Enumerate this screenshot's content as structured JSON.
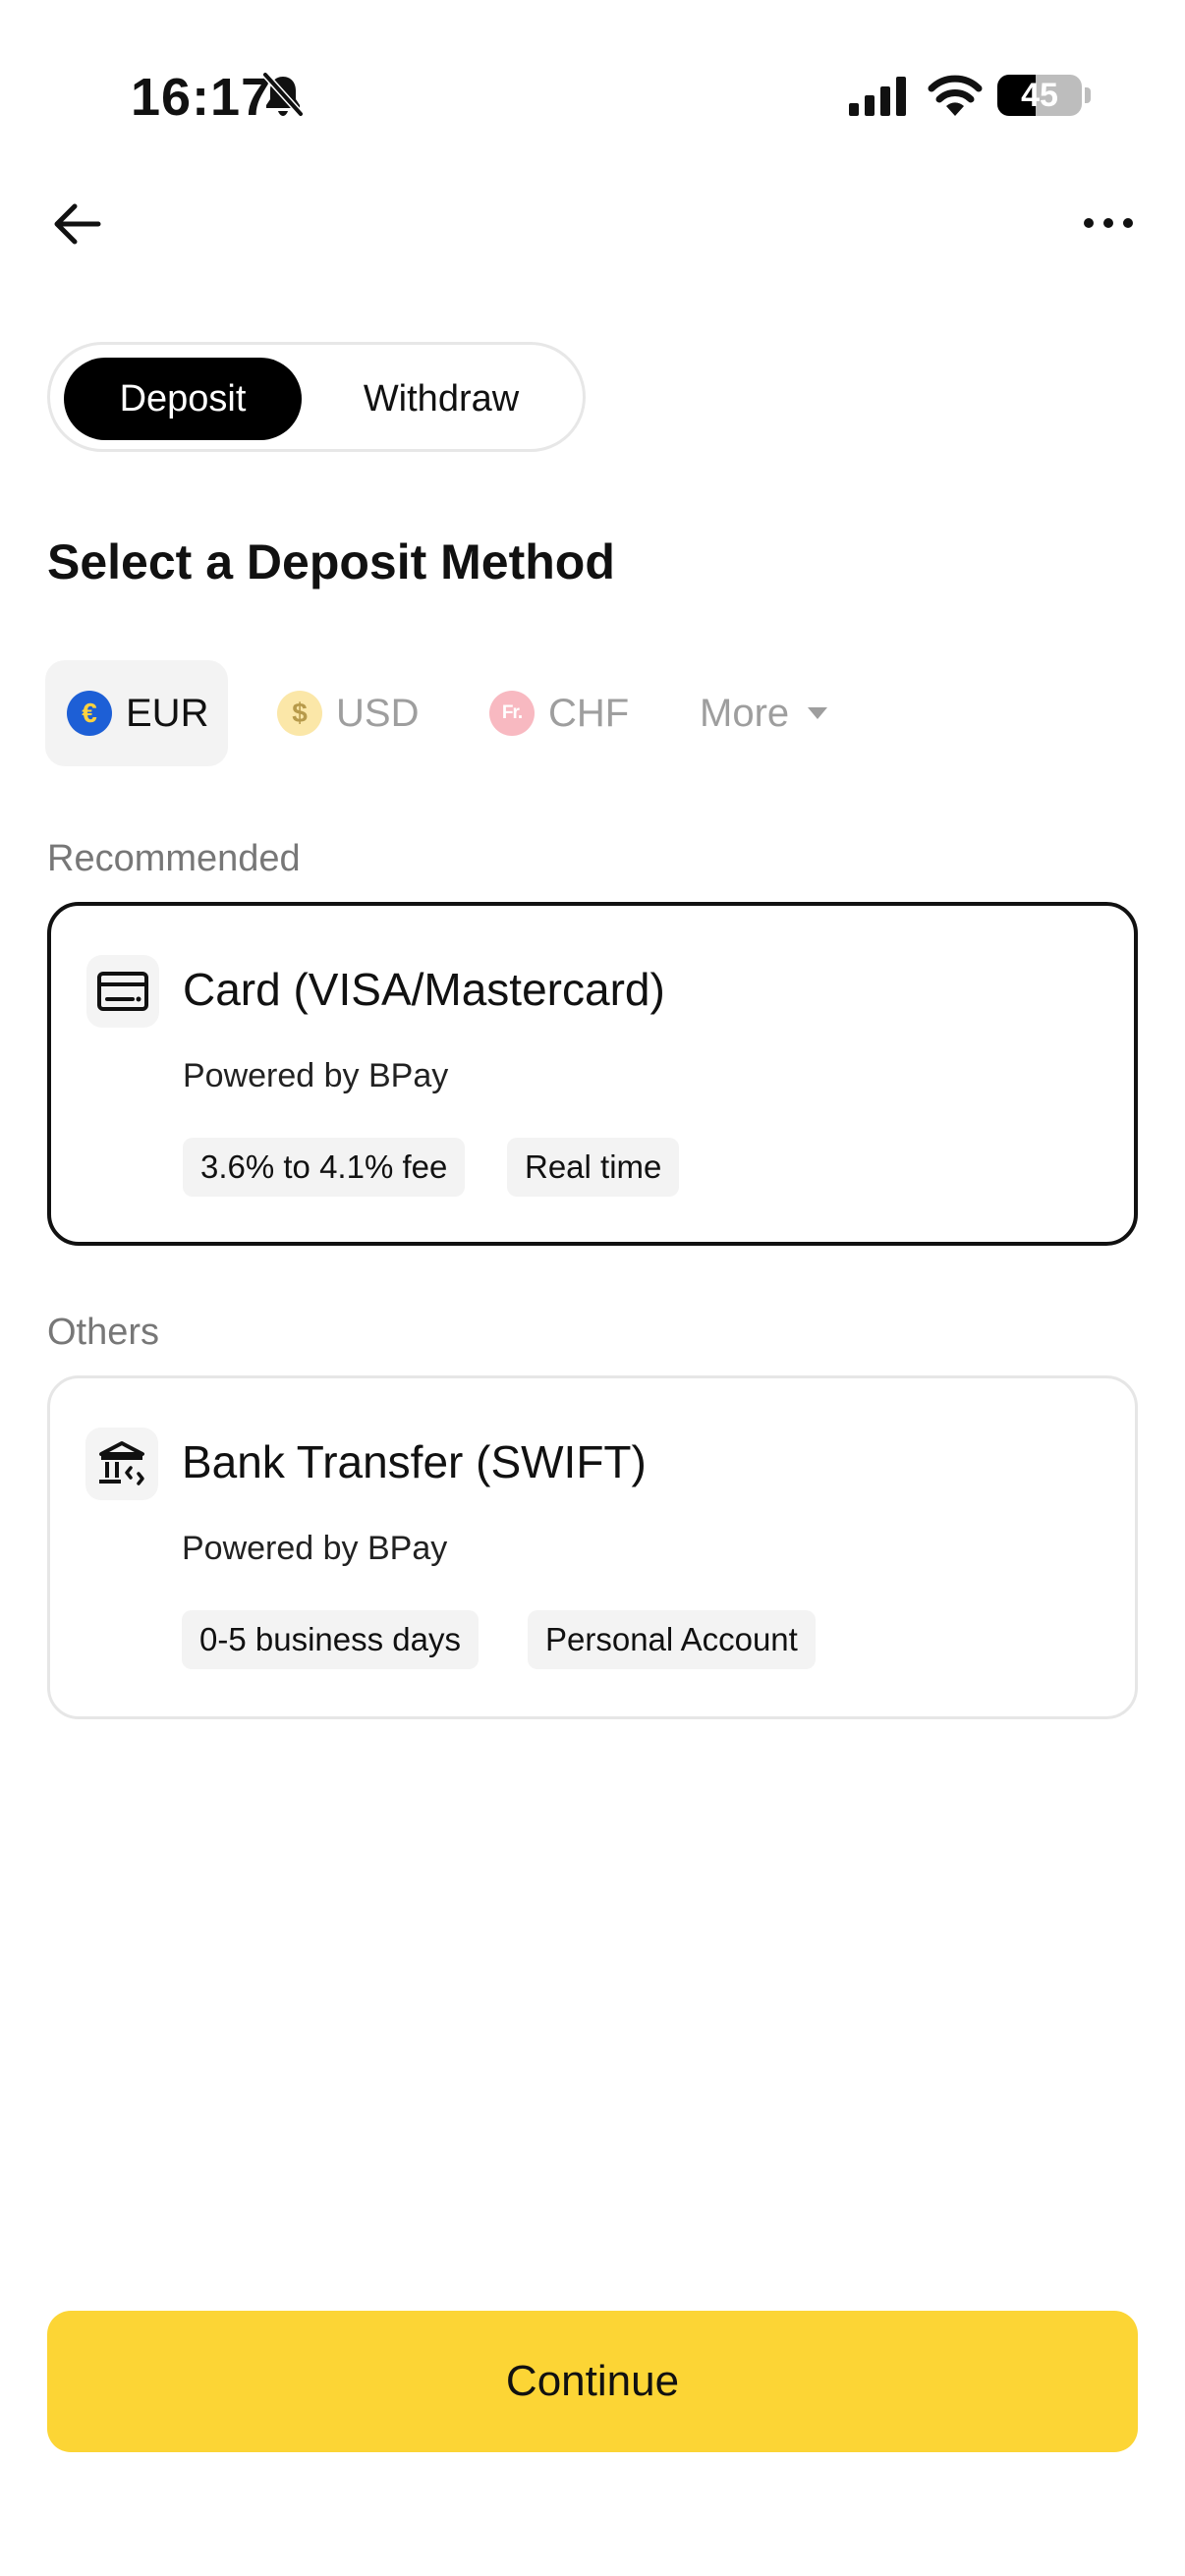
{
  "status_bar": {
    "time": "16:17",
    "battery_level": "45"
  },
  "toggle": {
    "deposit_label": "Deposit",
    "withdraw_label": "Withdraw",
    "selected": "Deposit"
  },
  "page_title": "Select a Deposit Method",
  "currencies": [
    {
      "code": "EUR",
      "symbol": "€",
      "active": true
    },
    {
      "code": "USD",
      "symbol": "$",
      "active": false
    },
    {
      "code": "CHF",
      "symbol": "Fr.",
      "active": false
    }
  ],
  "more_label": "More",
  "sections": {
    "recommended_label": "Recommended",
    "others_label": "Others"
  },
  "methods": [
    {
      "title": "Card (VISA/Mastercard)",
      "subtitle": "Powered by BPay",
      "tags": [
        "3.6% to 4.1% fee",
        "Real time"
      ],
      "icon": "credit-card-icon",
      "selected": true
    },
    {
      "title": "Bank Transfer (SWIFT)",
      "subtitle": "Powered by BPay",
      "tags": [
        "0-5 business days",
        "Personal Account"
      ],
      "icon": "bank-transfer-icon",
      "selected": false
    }
  ],
  "continue_label": "Continue",
  "colors": {
    "accent": "#FCD535",
    "selected_border": "#111111",
    "muted_text": "#777777"
  }
}
